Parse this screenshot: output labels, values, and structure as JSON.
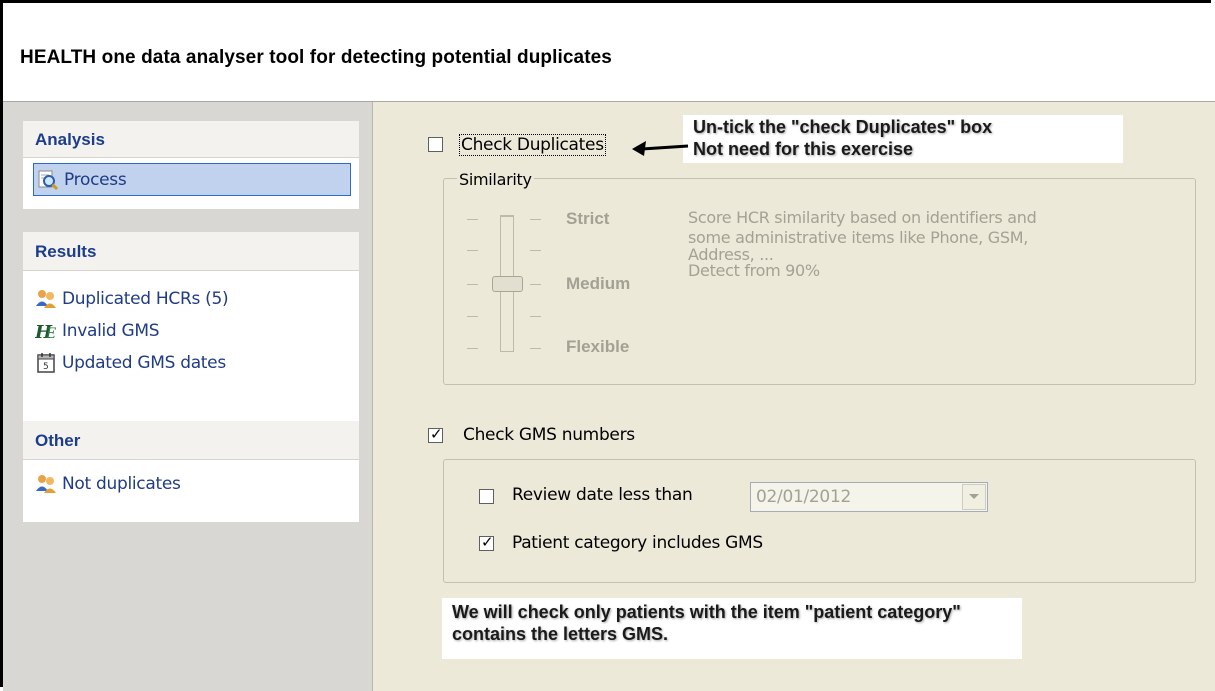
{
  "window": {
    "title": "HEALTH one data analyser tool for detecting potential duplicates"
  },
  "sidebar": {
    "groups": [
      {
        "header": "Analysis",
        "items": [
          {
            "label": "Process",
            "icon": "magnifier-icon",
            "selected": true
          }
        ]
      },
      {
        "header": "Results",
        "items": [
          {
            "label": "Duplicated HCRs (5)",
            "icon": "users-icon"
          },
          {
            "label": "Invalid GMS",
            "icon": "hse-logo-icon"
          },
          {
            "label": "Updated GMS dates",
            "icon": "calendar-icon"
          }
        ]
      },
      {
        "header": "Other",
        "items": [
          {
            "label": "Not duplicates",
            "icon": "users-icon"
          }
        ]
      }
    ]
  },
  "main": {
    "check_duplicates": {
      "label": "Check Duplicates",
      "checked": false
    },
    "similarity": {
      "legend": "Similarity",
      "levels": [
        "Strict",
        "Medium",
        "Flexible"
      ],
      "selected": "Medium",
      "description": [
        "Score HCR similarity based on identifiers and",
        "some administrative items like Phone, GSM,",
        "Address, ...",
        "Detect from 90%"
      ]
    },
    "check_gms": {
      "label": "Check GMS numbers",
      "checked": true
    },
    "review_date": {
      "label": "Review date less than",
      "checked": false,
      "value": "02/01/2012"
    },
    "patient_category": {
      "label": "Patient category includes GMS",
      "checked": true
    }
  },
  "annotations": {
    "top_note": [
      "Un-tick the \"check Duplicates\" box",
      "Not need for this exercise"
    ],
    "bottom_note": [
      "We will check only patients with the item \"patient category\"",
      "contains the letters GMS."
    ]
  },
  "colors": {
    "sidebar_header_text": "#1c3d8c",
    "sidebar_item_text": "#1f3c84",
    "selection_border": "#316ac5",
    "panel_bg": "#ece9d8",
    "disabled_text": "#a3a194"
  }
}
